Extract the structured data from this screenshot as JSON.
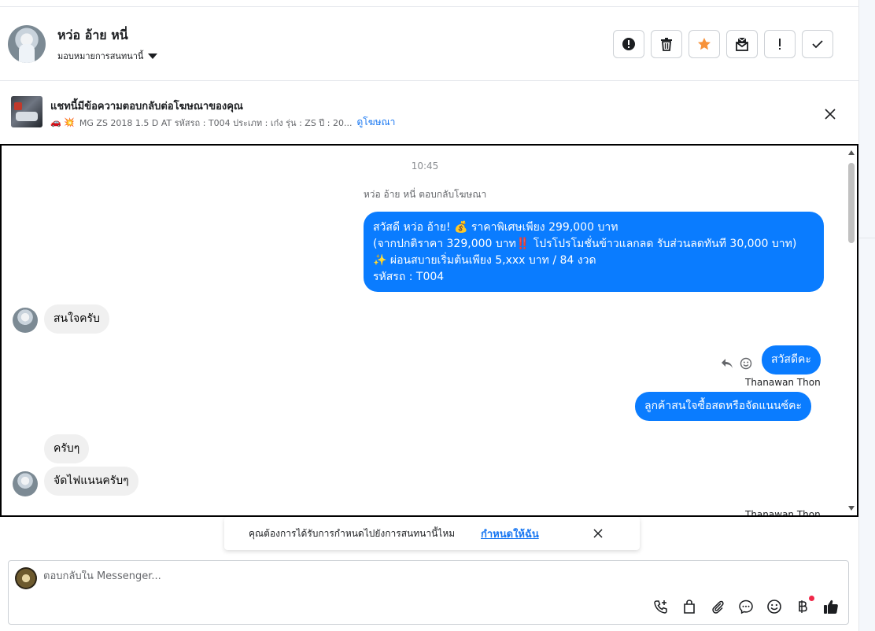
{
  "header": {
    "contact_name": "หว่อ อ้าย หนี่",
    "assign_label": "มอบหมายการสนทนานี้",
    "actions": [
      {
        "icon": "alert-circle-icon"
      },
      {
        "icon": "trash-icon"
      },
      {
        "icon": "star-icon",
        "color": "#f7923a"
      },
      {
        "icon": "mark-unread-icon"
      },
      {
        "icon": "exclamation-icon"
      },
      {
        "icon": "check-icon"
      }
    ]
  },
  "ad": {
    "title": "แชทนี้มีข้อความตอบกลับต่อโฆษณาของคุณ",
    "emojis": "🚗 💥",
    "summary": "MG ZS 2018 1.5 D AT รหัสรถ : T004 ประเภท : เก๋ง รุ่น : ZS ปี : 20...",
    "link_label": "ดูโฆษณา"
  },
  "chat": {
    "timestamp": "10:45",
    "reply_note": "หว่อ อ้าย หนี่ ตอบกลับโฆษณา",
    "ad_message_lines": [
      "สวัสดี หว่อ อ้าย! 💰 ราคาพิเศษเพียง 299,000 บาท",
      "(จากปกติราคา 329,000 บาท‼️ โปรโปรโมชั่นข้าวแลกลด รับส่วนลดทันที 30,000 บาท)",
      "✨ ผ่อนสบายเริ่มต้นเพียง 5,xxx บาท / 84 งวด",
      "รหัสรถ : T004"
    ],
    "incoming_1": "สนใจครับ",
    "outgoing_1": "สวัสดีคะ",
    "sender_1": "Thanawan Thon",
    "outgoing_2": "ลูกค้าสนใจซื้อสดหรือจัดแนนซ์คะ",
    "incoming_2": "ครับๆ",
    "incoming_3": "จัดไฟแนนครับๆ",
    "sender_2": "Thanawan Thon"
  },
  "toast": {
    "text": "คุณต้องการได้รับการกำหนดไปยังการสนทนานี้ไหม",
    "link_label": "กำหนดให้ฉัน"
  },
  "composer": {
    "placeholder": "ตอบกลับใน Messenger...",
    "tools": [
      "call-add-icon",
      "shopping-bag-icon",
      "paperclip-icon",
      "chat-bubble-icon",
      "emoji-icon",
      "baht-icon",
      "thumbs-up-icon"
    ],
    "accent_color": "#0a7cff"
  }
}
